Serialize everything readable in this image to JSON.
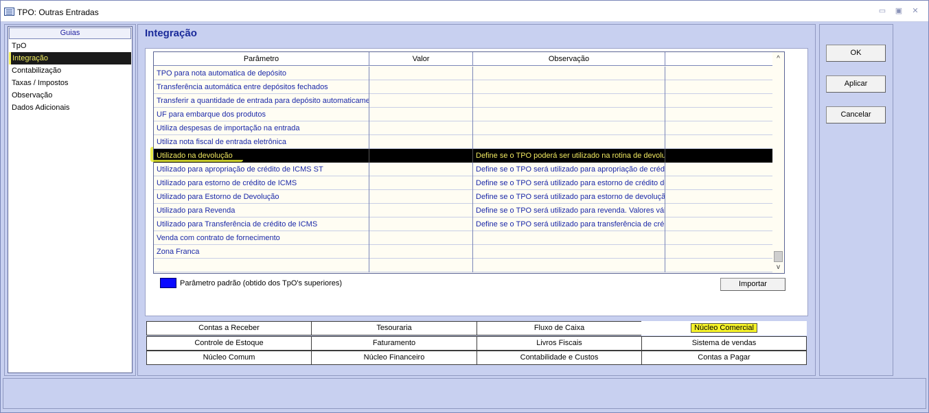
{
  "window": {
    "title": "TPO: Outras Entradas",
    "controls": [
      "▭",
      "▣",
      "✕"
    ]
  },
  "guias": {
    "header": "Guias",
    "items": [
      "TpO",
      "Integração",
      "Contabilização",
      "Taxas / Impostos",
      "Observação",
      "Dados Adicionais"
    ],
    "selected_index": 1
  },
  "section_title": "Integração",
  "grid": {
    "columns": [
      "Parâmetro",
      "Valor",
      "Observação",
      ""
    ],
    "rows": [
      {
        "parametro": "TPO para nota automatica de depósito",
        "valor": "",
        "observacao": ""
      },
      {
        "parametro": "Transferência automática entre depósitos fechados",
        "valor": "",
        "observacao": ""
      },
      {
        "parametro": "Transferir a quantidade de entrada para depósito automaticame",
        "valor": "",
        "observacao": ""
      },
      {
        "parametro": "UF para embarque dos produtos",
        "valor": "",
        "observacao": ""
      },
      {
        "parametro": "Utiliza despesas de importação na entrada",
        "valor": "",
        "observacao": ""
      },
      {
        "parametro": "Utiliza nota fiscal de entrada eletrônica",
        "valor": "",
        "observacao": ""
      },
      {
        "parametro": "Utilizado na devolução",
        "valor": "",
        "observacao": "Define se o TPO poderá ser utilizado na rotina de devoluç"
      },
      {
        "parametro": "Utilizado para apropriação de crédito de ICMS ST",
        "valor": "",
        "observacao": "Define se o TPO será utilizado para apropriação de crédi"
      },
      {
        "parametro": "Utilizado para estorno de crédito de ICMS",
        "valor": "",
        "observacao": "Define se o TPO será utilizado para estorno de crédito de"
      },
      {
        "parametro": "Utilizado para Estorno de Devolução",
        "valor": "",
        "observacao": "Define se o TPO será utilizado para estorno de devoluçã"
      },
      {
        "parametro": "Utilizado para Revenda",
        "valor": "",
        "observacao": "Define se o TPO será utilizado para revenda. Valores vál"
      },
      {
        "parametro": "Utilizado para Transferência de crédito de ICMS",
        "valor": "",
        "observacao": "Define se o TPO será utilizado para transferência de cré"
      },
      {
        "parametro": "Venda com contrato de fornecimento",
        "valor": "",
        "observacao": ""
      },
      {
        "parametro": "Zona Franca",
        "valor": "",
        "observacao": ""
      },
      {
        "parametro": "",
        "valor": "",
        "observacao": ""
      }
    ],
    "selected_index": 6
  },
  "scroll": {
    "up": "^",
    "down": "v"
  },
  "legend": {
    "text": "Parâmetro padrão (obtido dos TpO's superiores)",
    "color": "#0a0aff"
  },
  "importar_label": "Importar",
  "tabs": {
    "row1": [
      "Contas a Receber",
      "Tesouraria",
      "Fluxo de Caixa",
      "Núcleo Comercial"
    ],
    "row2": [
      "Controle de Estoque",
      "Faturamento",
      "Livros Fiscais",
      "Sistema de vendas"
    ],
    "row3": [
      "Núcleo Comum",
      "Núcleo Financeiro",
      "Contabilidade e Custos",
      "Contas a Pagar"
    ],
    "active": "Núcleo Comercial"
  },
  "actions": {
    "ok": "OK",
    "aplicar": "Aplicar",
    "cancelar": "Cancelar"
  }
}
